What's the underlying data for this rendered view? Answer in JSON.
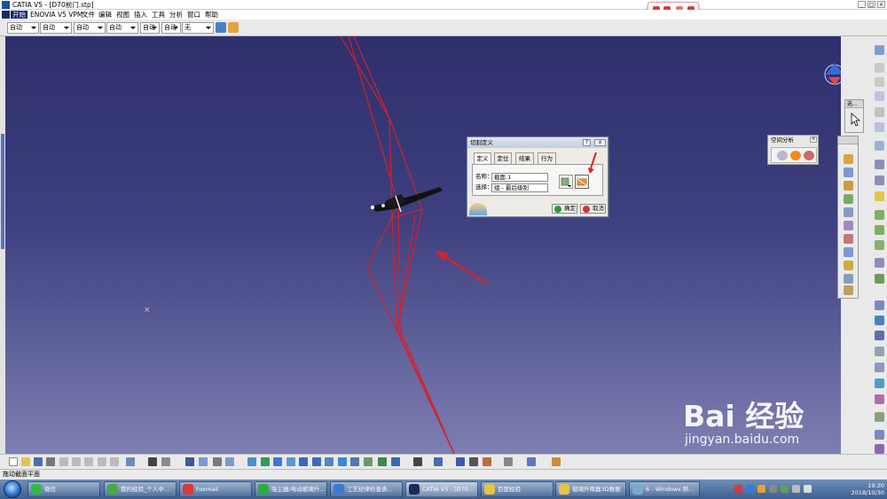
{
  "window": {
    "title": "CATIA V5 - [D70前门.stp]"
  },
  "menu": {
    "start": "开始",
    "items": [
      "ENOVIA V5 VPM",
      "文件",
      "编辑",
      "视图",
      "插入",
      "工具",
      "分析",
      "窗口",
      "帮助"
    ]
  },
  "toolbar_top": {
    "combos": [
      "自动",
      "自动",
      "自动",
      "自动",
      "自动",
      "自动",
      "无"
    ]
  },
  "viewport": {
    "axis_x_label": "x"
  },
  "dialog": {
    "title": "切割定义",
    "help": "?",
    "close": "x",
    "tabs": [
      "定义",
      "定位",
      "结果",
      "行为"
    ],
    "name_label": "名称：",
    "name_value": "截面.1",
    "selection_label": "选择：",
    "selection_value": "组 - 最后级别",
    "ok": "确定",
    "cancel": "取消"
  },
  "space_analysis": {
    "title": "空间分析"
  },
  "select_toolbar": {
    "title": "选..."
  },
  "status": {
    "text": "拖动截面平面"
  },
  "taskbar": {
    "items": [
      "微信",
      "我的经验_个人中...",
      "Foxmail",
      "吸尘器/电动玻璃升...",
      "工艺纪律检查表...",
      "CATIA V5 - [D70...",
      "百度经验",
      "玻璃升降器3D数据",
      "6 - Windows 照..."
    ],
    "time": "19:20",
    "date": "2018/10/30"
  },
  "watermark": {
    "brand": "Bai  经验",
    "url": "jingyan.baidu.com"
  },
  "colors": {
    "viewport_top": "#2e2f6b",
    "viewport_bottom": "#7d7fb2",
    "annotation_red": "#e02020",
    "dialog_title": "#c3cde0"
  }
}
